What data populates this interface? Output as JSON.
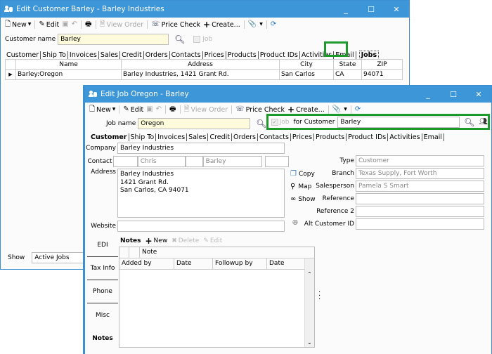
{
  "customer_window": {
    "title": "Edit Customer Barley - Barley Industries",
    "window_controls": [
      "minimize",
      "maximize",
      "close"
    ],
    "toolbar": {
      "new": "New",
      "edit": "Edit",
      "view_order": "View Order",
      "price_check": "Price Check",
      "create": "Create..."
    },
    "name_label": "Customer name",
    "name_value": "Barley",
    "job_checkbox_label": "Job",
    "tabs": [
      "Customer",
      "Ship To",
      "Invoices",
      "Sales",
      "Credit",
      "Orders",
      "Contacts",
      "Prices",
      "Products",
      "Product IDs",
      "Activities",
      "Email",
      "Jobs"
    ],
    "active_tab": "Jobs",
    "grid": {
      "columns": [
        "Name",
        "Address",
        "City",
        "State",
        "ZIP"
      ],
      "rows": [
        {
          "name": "Barley:Oregon",
          "address": "Barley Industries, 1421 Grant Rd.",
          "city": "San Carlos",
          "state": "CA",
          "zip": "94071"
        }
      ]
    },
    "show_label": "Show",
    "show_value": "Active Jobs"
  },
  "job_window": {
    "title": "Edit Job Oregon - Barley",
    "window_controls": [
      "minimize",
      "maximize",
      "close"
    ],
    "toolbar": {
      "new": "New",
      "edit": "Edit",
      "view_order": "View Order",
      "price_check": "Price Check",
      "create": "Create..."
    },
    "name_label": "Job name",
    "name_value": "Oregon",
    "job_checkbox_label": "Job",
    "for_customer_label": "for Customer",
    "for_customer_value": "Barley",
    "tabs": [
      "Customer",
      "Ship To",
      "Invoices",
      "Sales",
      "Credit",
      "Orders",
      "Contacts",
      "Prices",
      "Products",
      "Product IDs",
      "Activities",
      "Email"
    ],
    "active_tab": "Customer",
    "form": {
      "company_label": "Company",
      "company_value": "Barley Industries",
      "contact_label": "Contact",
      "contact_first": "Chris",
      "contact_last": "Barley",
      "address_label": "Address",
      "address_lines": [
        "Barley Industries",
        "1421 Grant Rd.",
        "San Carlos, CA 94071"
      ],
      "website_label": "Website",
      "website_value": "",
      "copy_label": "Copy",
      "map_label": "Map",
      "show_label": "Show",
      "type_label": "Type",
      "type_value": "Customer",
      "branch_label": "Branch",
      "branch_value": "Texas Supply, Fort Worth",
      "salesperson_label": "Salesperson",
      "salesperson_value": "Pamela S Smart",
      "reference_label": "Reference",
      "reference_value": "",
      "reference2_label": "Reference 2",
      "reference2_value": "",
      "alt_customer_id_label": "Alt Customer ID",
      "alt_customer_id_value": ""
    },
    "side_tabs": [
      "EDI",
      "Tax Info",
      "Phone",
      "Misc",
      "Notes"
    ],
    "active_side_tab": "Notes",
    "notes": {
      "title": "Notes",
      "new": "New",
      "delete": "Delete",
      "edit": "Edit",
      "header_note": "Note",
      "columns": [
        "Added by",
        "Date",
        "Followup by",
        "Date"
      ]
    }
  },
  "colors": {
    "titlebar": "#3c96d8",
    "highlight": "#1e9a2c",
    "input_yellow": "#fdfbdc"
  }
}
